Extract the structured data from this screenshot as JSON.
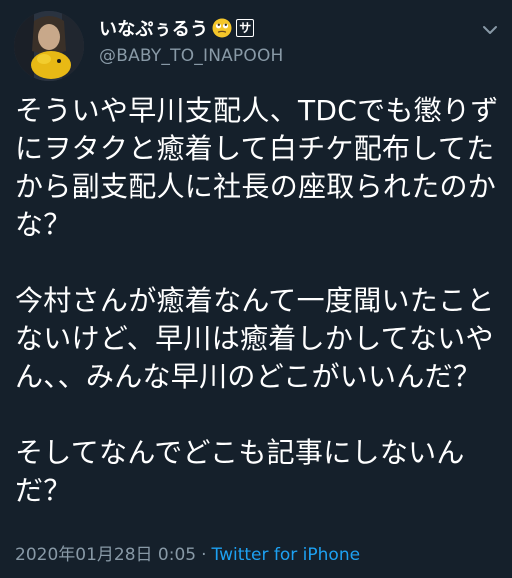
{
  "user": {
    "display_name": "いなぷぅるう",
    "box_label": "サ",
    "handle": "@BABY_TO_INAPOOH"
  },
  "tweet": {
    "text": "そういや早川支配人、TDCでも懲りずにヲタクと癒着して白チケ配布してたから副支配人に社長の座取られたのかな？\n\n今村さんが癒着なんて一度聞いたことないけど、早川は癒着しかしてないやん、、みんな早川のどこがいいんだ？\n\nそしてなんでどこも記事にしないんだ？"
  },
  "footer": {
    "timestamp": "2020年01月28日 0:05",
    "separator": "·",
    "source": "Twitter for iPhone"
  },
  "colors": {
    "background": "#15202b",
    "text": "#ffffff",
    "secondary": "#8899a6",
    "link": "#1da1f2"
  },
  "icons": {
    "emoji": "rolling-eyes-emoji-icon",
    "more": "chevron-down-icon"
  }
}
